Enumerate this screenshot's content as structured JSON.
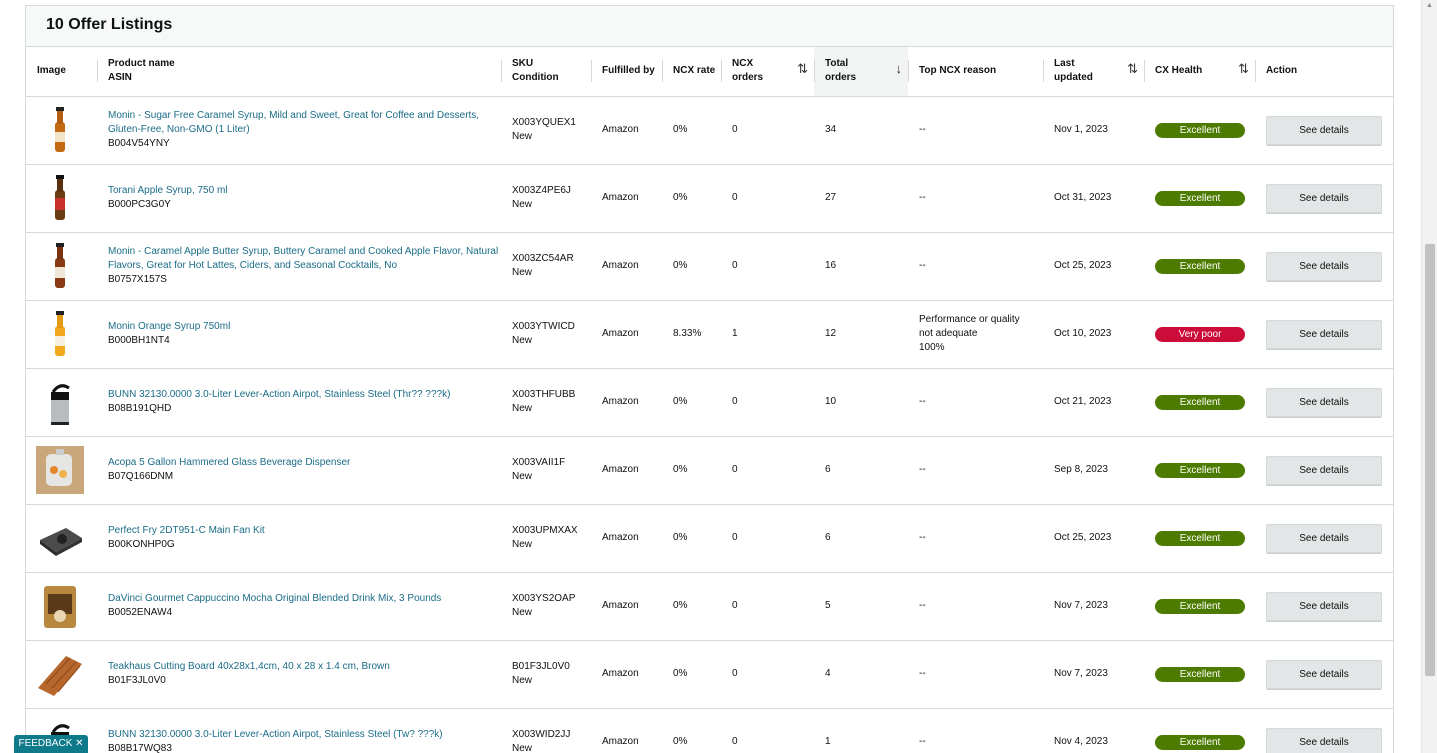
{
  "header": {
    "title": "10 Offer Listings"
  },
  "columns": {
    "image": "Image",
    "product_name": "Product name",
    "asin": "ASIN",
    "sku": "SKU",
    "condition": "Condition",
    "fulfilled_by": "Fulfilled by",
    "ncx_rate": "NCX rate",
    "ncx_orders_1": "NCX",
    "ncx_orders_2": "orders",
    "total_orders_1": "Total",
    "total_orders_2": "orders",
    "top_ncx_reason": "Top NCX reason",
    "last_updated_1": "Last",
    "last_updated_2": "updated",
    "cx_health": "CX Health",
    "action": "Action"
  },
  "colors": {
    "excellent": "#4d7b00",
    "very_poor": "#cc0c39",
    "link": "#1a6c87"
  },
  "rows": [
    {
      "icon": "syrup-bottle-caramel",
      "name": "Monin - Sugar Free Caramel Syrup, Mild and Sweet, Great for Coffee and Desserts, Gluten-Free, Non-GMO (1 Liter)",
      "asin": "B004V54YNY",
      "sku": "X003YQUEX1",
      "condition": "New",
      "fulfilled": "Amazon",
      "ncx_rate": "0%",
      "ncx_orders": "0",
      "total_orders": "34",
      "reason_1": "--",
      "reason_2": "",
      "reason_3": "",
      "updated": "Nov 1, 2023",
      "health": "Excellent",
      "action": "See details"
    },
    {
      "icon": "syrup-bottle-apple",
      "name": "Torani Apple Syrup, 750 ml",
      "asin": "B000PC3G0Y",
      "sku": "X003Z4PE6J",
      "condition": "New",
      "fulfilled": "Amazon",
      "ncx_rate": "0%",
      "ncx_orders": "0",
      "total_orders": "27",
      "reason_1": "--",
      "reason_2": "",
      "reason_3": "",
      "updated": "Oct 31, 2023",
      "health": "Excellent",
      "action": "See details"
    },
    {
      "icon": "syrup-bottle-apple-butter",
      "name": "Monin - Caramel Apple Butter Syrup, Buttery Caramel and Cooked Apple Flavor, Natural Flavors, Great for Hot Lattes, Ciders, and Seasonal Cocktails, No",
      "asin": "B0757X157S",
      "sku": "X003ZC54AR",
      "condition": "New",
      "fulfilled": "Amazon",
      "ncx_rate": "0%",
      "ncx_orders": "0",
      "total_orders": "16",
      "reason_1": "--",
      "reason_2": "",
      "reason_3": "",
      "updated": "Oct 25, 2023",
      "health": "Excellent",
      "action": "See details"
    },
    {
      "icon": "syrup-bottle-orange",
      "name": "Monin Orange Syrup 750ml",
      "asin": "B000BH1NT4",
      "sku": "X003YTWICD",
      "condition": "New",
      "fulfilled": "Amazon",
      "ncx_rate": "8.33%",
      "ncx_orders": "1",
      "total_orders": "12",
      "reason_1": "Performance or quality",
      "reason_2": "not adequate",
      "reason_3": "100%",
      "updated": "Oct 10, 2023",
      "health": "Very poor",
      "action": "See details"
    },
    {
      "icon": "airpot",
      "name": "BUNN 32130.0000 3.0-Liter Lever-Action Airpot, Stainless Steel (Thr?? ???k)",
      "asin": "B08B191QHD",
      "sku": "X003THFUBB",
      "condition": "New",
      "fulfilled": "Amazon",
      "ncx_rate": "0%",
      "ncx_orders": "0",
      "total_orders": "10",
      "reason_1": "--",
      "reason_2": "",
      "reason_3": "",
      "updated": "Oct 21, 2023",
      "health": "Excellent",
      "action": "See details"
    },
    {
      "icon": "beverage-dispenser",
      "name": "Acopa 5 Gallon Hammered Glass Beverage Dispenser",
      "asin": "B07Q166DNM",
      "sku": "X003VAII1F",
      "condition": "New",
      "fulfilled": "Amazon",
      "ncx_rate": "0%",
      "ncx_orders": "0",
      "total_orders": "6",
      "reason_1": "--",
      "reason_2": "",
      "reason_3": "",
      "updated": "Sep 8, 2023",
      "health": "Excellent",
      "action": "See details"
    },
    {
      "icon": "fan-kit",
      "name": "Perfect Fry 2DT951-C Main Fan Kit",
      "asin": "B00KONHP0G",
      "sku": "X003UPMXAX",
      "condition": "New",
      "fulfilled": "Amazon",
      "ncx_rate": "0%",
      "ncx_orders": "0",
      "total_orders": "6",
      "reason_1": "--",
      "reason_2": "",
      "reason_3": "",
      "updated": "Oct 25, 2023",
      "health": "Excellent",
      "action": "See details"
    },
    {
      "icon": "drink-mix-bag",
      "name": "DaVinci Gourmet Cappuccino Mocha Original Blended Drink Mix, 3 Pounds",
      "asin": "B0052ENAW4",
      "sku": "X003YS2OAP",
      "condition": "New",
      "fulfilled": "Amazon",
      "ncx_rate": "0%",
      "ncx_orders": "0",
      "total_orders": "5",
      "reason_1": "--",
      "reason_2": "",
      "reason_3": "",
      "updated": "Nov 7, 2023",
      "health": "Excellent",
      "action": "See details"
    },
    {
      "icon": "cutting-board",
      "name": "Teakhaus Cutting Board 40x28x1,4cm, 40 x 28 x 1.4 cm, Brown",
      "asin": "B01F3JL0V0",
      "sku": "B01F3JL0V0",
      "condition": "New",
      "fulfilled": "Amazon",
      "ncx_rate": "0%",
      "ncx_orders": "0",
      "total_orders": "4",
      "reason_1": "--",
      "reason_2": "",
      "reason_3": "",
      "updated": "Nov 7, 2023",
      "health": "Excellent",
      "action": "See details"
    },
    {
      "icon": "airpot-2",
      "name": "BUNN 32130.0000 3.0-Liter Lever-Action Airpot, Stainless Steel (Tw? ???k)",
      "asin": "B08B17WQ83",
      "sku": "X003WID2JJ",
      "condition": "New",
      "fulfilled": "Amazon",
      "ncx_rate": "0%",
      "ncx_orders": "0",
      "total_orders": "1",
      "reason_1": "--",
      "reason_2": "",
      "reason_3": "",
      "updated": "Nov 4, 2023",
      "health": "Excellent",
      "action": "See details"
    }
  ],
  "feedback": {
    "label": "FEEDBACK ✕"
  }
}
